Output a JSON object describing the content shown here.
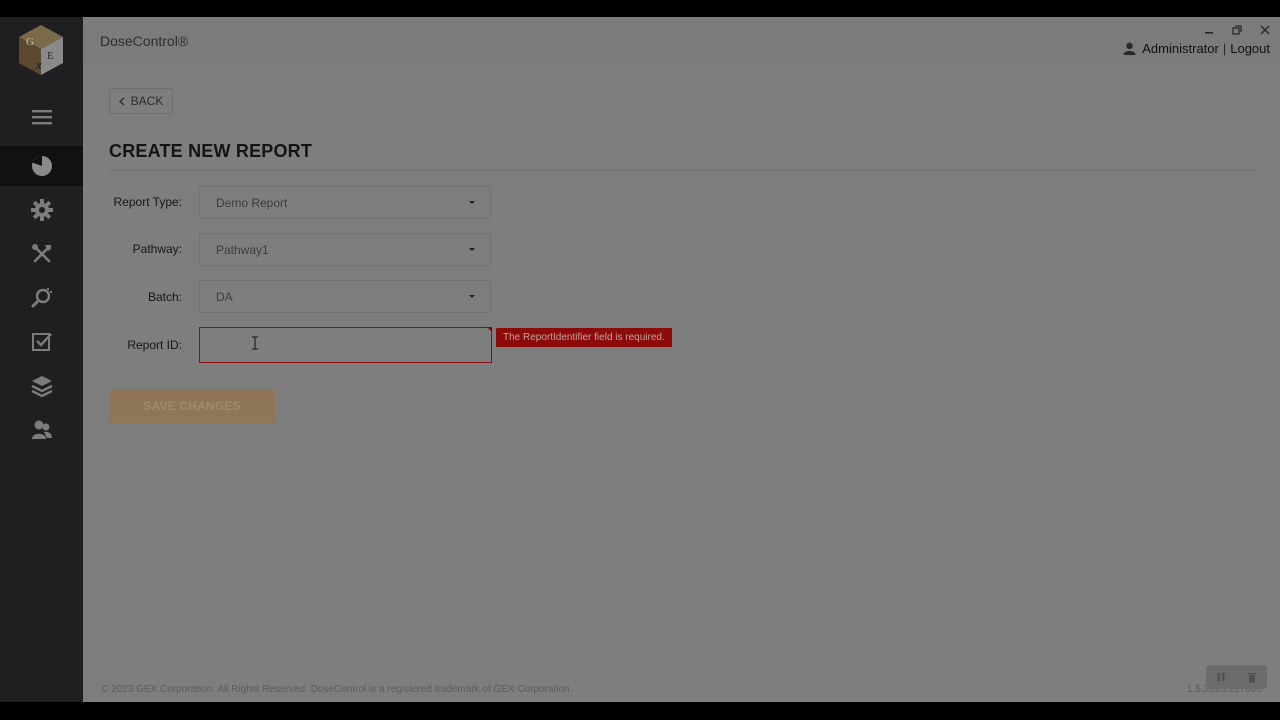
{
  "app": {
    "title": "DoseControl®"
  },
  "user": {
    "name": "Administrator",
    "separator": "|",
    "logout_label": "Logout"
  },
  "window_controls": {
    "minimize": "minimize-icon",
    "restore": "restore-icon",
    "close": "close-icon"
  },
  "sidebar": {
    "items": [
      {
        "icon": "menu-icon",
        "active": false
      },
      {
        "icon": "dashboard-pie-icon",
        "active": true
      },
      {
        "icon": "settings-gear-icon",
        "active": false
      },
      {
        "icon": "tools-icon",
        "active": false
      },
      {
        "icon": "inspect-search-icon",
        "active": false
      },
      {
        "icon": "checklist-icon",
        "active": false
      },
      {
        "icon": "layers-icon",
        "active": false
      },
      {
        "icon": "users-icon",
        "active": false
      }
    ]
  },
  "page": {
    "back_label": "BACK",
    "title": "CREATE NEW REPORT",
    "form": {
      "report_type": {
        "label": "Report Type:",
        "value": "Demo Report"
      },
      "pathway": {
        "label": "Pathway:",
        "value": "Pathway1"
      },
      "batch": {
        "label": "Batch:",
        "value": "DA"
      },
      "report_id": {
        "label": "Report ID:",
        "value": "",
        "error": "The ReportIdentifier field is required."
      }
    },
    "save_label": "SAVE CHANGES"
  },
  "footer": {
    "copyright": "© 2023 GEX Corporation. All Rights Reserved. DoseControl is a registered trademark of GEX Corporation.",
    "version": "1.5.2023.217000"
  },
  "colors": {
    "sidebar": "#1f1f21",
    "error": "#8c0a0a",
    "accent": "#8e7656"
  }
}
